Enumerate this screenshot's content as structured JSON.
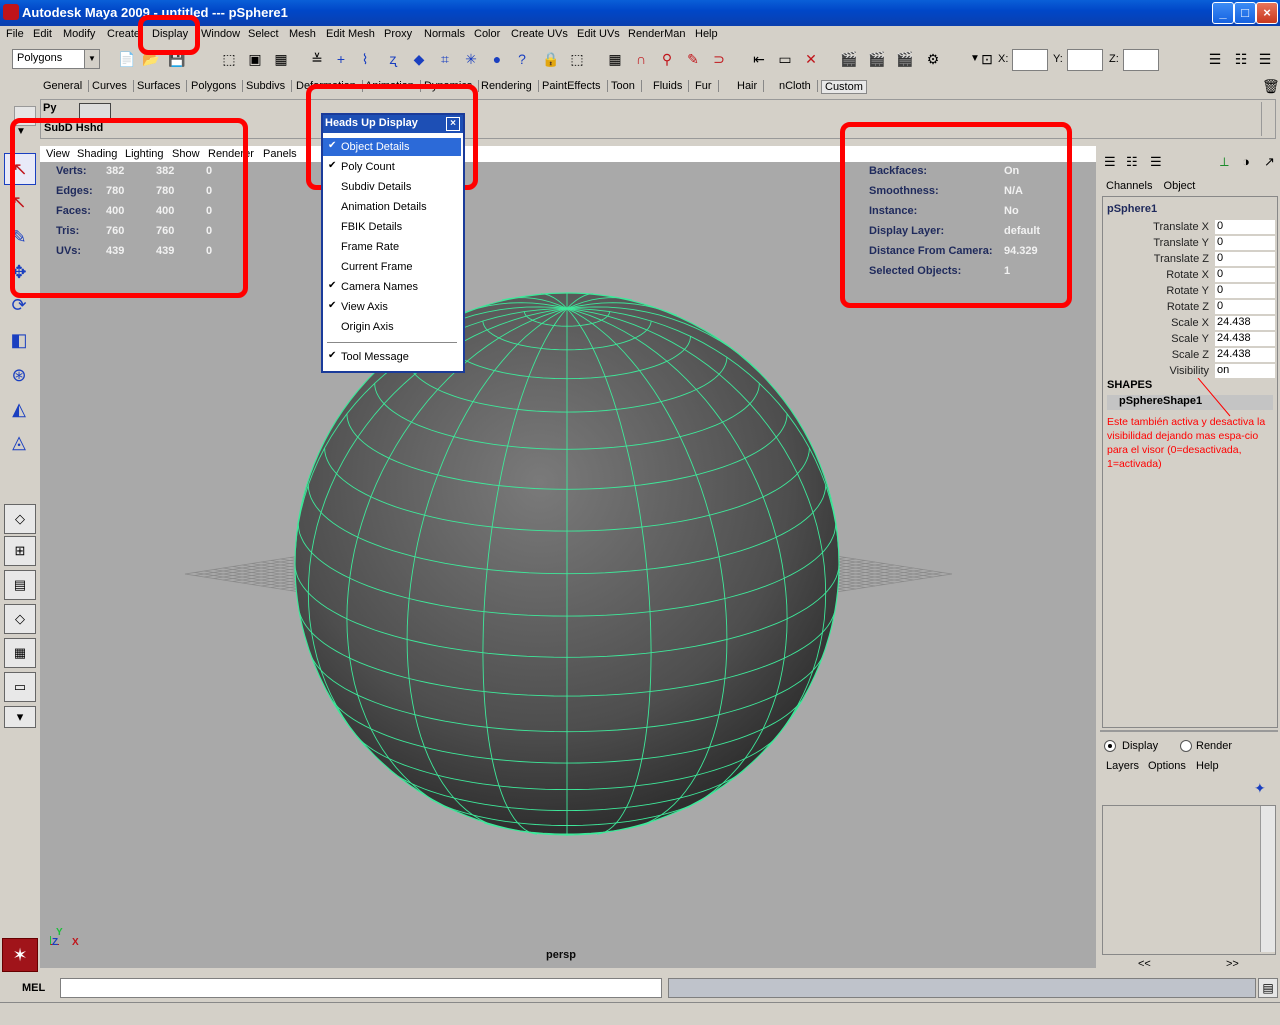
{
  "title_bar": {
    "title": "Autodesk Maya 2009 - untitled   ---   pSphere1",
    "buttons": [
      "_",
      "□",
      "×"
    ]
  },
  "menu_bar": {
    "items": [
      "File",
      "Edit",
      "Modify",
      "Create",
      "Display",
      "Window",
      "Select",
      "Mesh",
      "Edit Mesh",
      "Proxy",
      "Normals",
      "Color",
      "Create UVs",
      "Edit UVs",
      "RenderMan",
      "Help"
    ]
  },
  "toolbar": {
    "mode": "Polygons",
    "coords": {
      "x_label": "X:",
      "y_label": "Y:",
      "z_label": "Z:"
    }
  },
  "shelf_tabs": [
    "General",
    "Curves",
    "Surfaces",
    "Polygons",
    "Subdivs",
    "Deformation",
    "Animation",
    "Dynamics",
    "Rendering",
    "PaintEffects",
    "Toon",
    "Fluids",
    "Fur",
    "Hair",
    "nCloth",
    "Custom"
  ],
  "shelf": {
    "mode_label": "SubD Hshd",
    "py_label": "Py"
  },
  "panel_menu": [
    "View",
    "Shading",
    "Lighting",
    "Show",
    "Renderer",
    "Panels"
  ],
  "hud_left": {
    "rows": [
      {
        "label": "Verts:",
        "a": "382",
        "b": "382",
        "c": "0"
      },
      {
        "label": "Edges:",
        "a": "780",
        "b": "780",
        "c": "0"
      },
      {
        "label": "Faces:",
        "a": "400",
        "b": "400",
        "c": "0"
      },
      {
        "label": "Tris:",
        "a": "760",
        "b": "760",
        "c": "0"
      },
      {
        "label": "UVs:",
        "a": "439",
        "b": "439",
        "c": "0"
      }
    ]
  },
  "hud_right": {
    "rows": [
      {
        "label": "Backfaces:",
        "value": "On"
      },
      {
        "label": "Smoothness:",
        "value": "N/A"
      },
      {
        "label": "Instance:",
        "value": "No"
      },
      {
        "label": "Display Layer:",
        "value": "default"
      },
      {
        "label": "Distance From Camera:",
        "value": "94.329"
      },
      {
        "label": "Selected Objects:",
        "value": "1"
      }
    ]
  },
  "camera_label": "persp",
  "hud_menu": {
    "title": "Heads Up Display",
    "items": [
      {
        "label": "Object Details",
        "checked": true,
        "selected": true
      },
      {
        "label": "Poly Count",
        "checked": true
      },
      {
        "label": "Subdiv Details",
        "checked": false
      },
      {
        "label": "Animation Details",
        "checked": false
      },
      {
        "label": "FBIK Details",
        "checked": false
      },
      {
        "label": "Frame Rate",
        "checked": false
      },
      {
        "label": "Current Frame",
        "checked": false
      },
      {
        "label": "Camera Names",
        "checked": true
      },
      {
        "label": "View Axis",
        "checked": true
      },
      {
        "label": "Origin Axis",
        "checked": false
      },
      {
        "label": "Tool Message",
        "checked": true
      }
    ]
  },
  "channel_box": {
    "tabs": [
      "Channels",
      "Object"
    ],
    "object": "pSphere1",
    "attributes": [
      {
        "name": "Translate X",
        "value": "0"
      },
      {
        "name": "Translate Y",
        "value": "0"
      },
      {
        "name": "Translate Z",
        "value": "0"
      },
      {
        "name": "Rotate X",
        "value": "0"
      },
      {
        "name": "Rotate Y",
        "value": "0"
      },
      {
        "name": "Rotate Z",
        "value": "0"
      },
      {
        "name": "Scale X",
        "value": "24.438"
      },
      {
        "name": "Scale Y",
        "value": "24.438"
      },
      {
        "name": "Scale Z",
        "value": "24.438"
      },
      {
        "name": "Visibility",
        "value": "on"
      }
    ],
    "shapes_label": "SHAPES",
    "shape_name": "pSphereShape1"
  },
  "annotation_note": "Este también activa y desactiva la visibilidad dejando mas espa-cio para el visor (0=desactivada, 1=activada)",
  "layer_editor": {
    "radio_display": "Display",
    "radio_render": "Render",
    "menu": [
      "Layers",
      "Options",
      "Help"
    ],
    "scroll_left": "<<",
    "scroll_right": ">>"
  },
  "command_line": {
    "label": "MEL"
  },
  "colors": {
    "wireframe": "#3ee89a",
    "annotation": "#ff0000",
    "hud_label": "#1f2a5c"
  }
}
